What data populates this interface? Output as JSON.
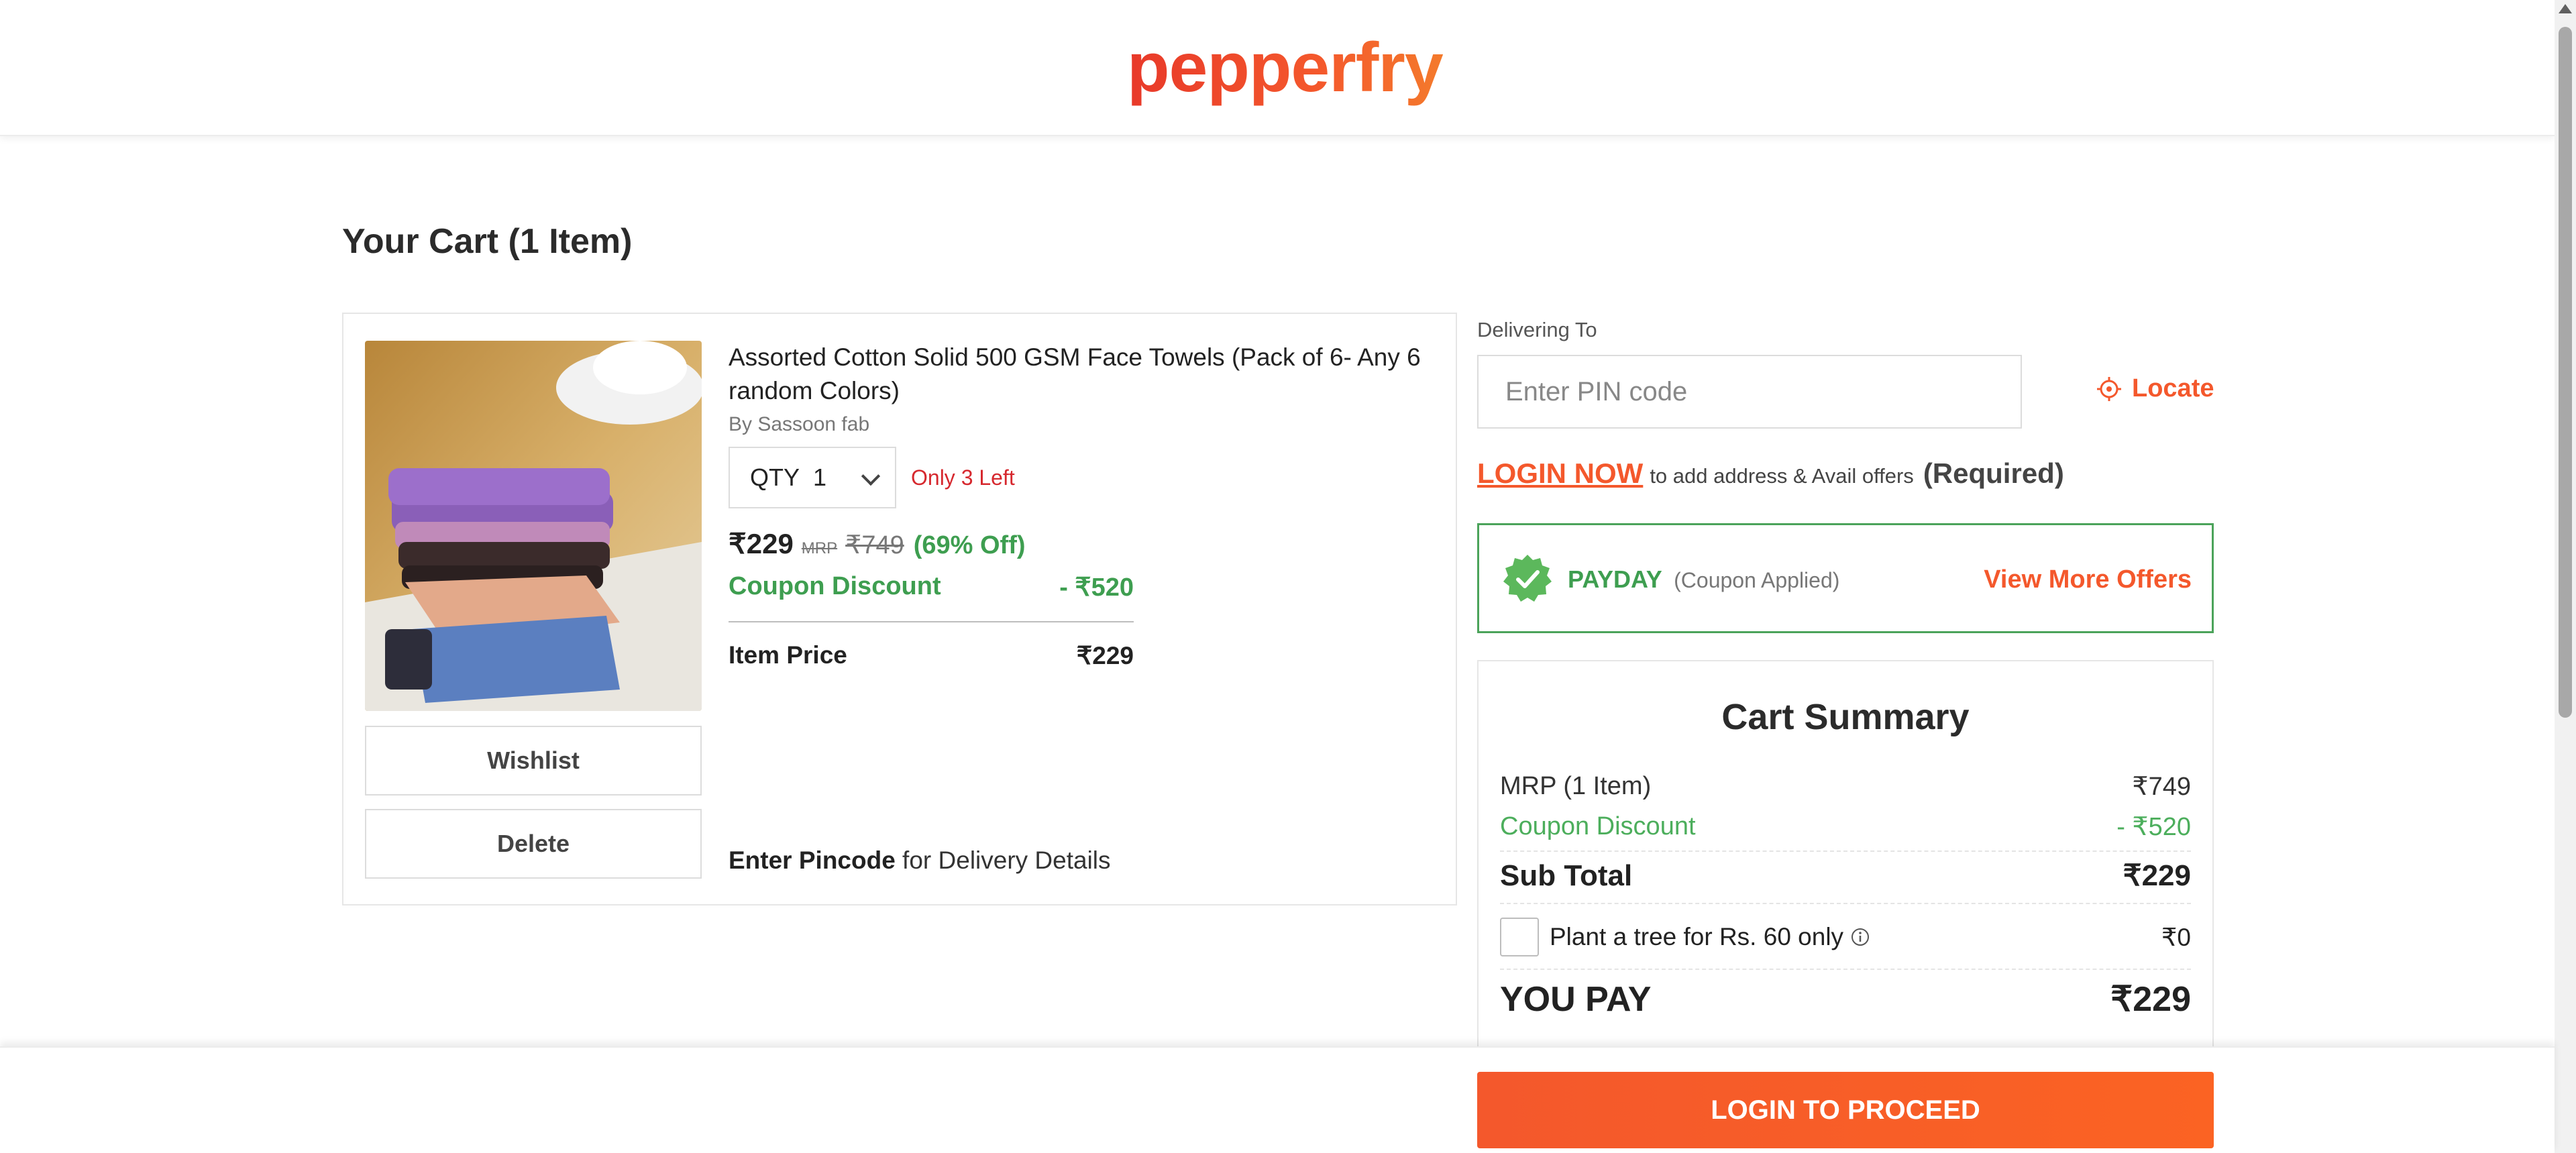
{
  "header": {
    "logo_text": "pepperfry",
    "brand_color": "#f4582c"
  },
  "cart": {
    "title": "Your Cart (1 Item)",
    "item": {
      "name": "Assorted Cotton Solid 500 GSM Face Towels (Pack of 6- Any 6 random Colors)",
      "seller": "By Sassoon fab",
      "qty_label": "QTY",
      "qty_value": "1",
      "stock_note": "Only 3 Left",
      "price": "₹229",
      "mrp_tag": "MRP",
      "mrp_price": "₹749",
      "discount_percent": "(69% Off)",
      "coupon_label": "Coupon Discount",
      "coupon_value": "- ₹520",
      "item_price_label": "Item Price",
      "item_price_value": "₹229",
      "wishlist_label": "Wishlist",
      "delete_label": "Delete",
      "pincode_bold": "Enter Pincode",
      "pincode_rest": " for Delivery Details"
    }
  },
  "delivery": {
    "label": "Delivering To",
    "pin_placeholder": "Enter PIN code",
    "locate_label": "Locate"
  },
  "login_prompt": {
    "link": "LOGIN NOW",
    "text": "to add address & Avail offers",
    "required": "(Required)"
  },
  "coupon_box": {
    "code": "PAYDAY",
    "status": "(Coupon Applied)",
    "view_more": "View More Offers",
    "accent": "#4ba35a"
  },
  "summary": {
    "title": "Cart Summary",
    "mrp_label": "MRP (1 Item)",
    "mrp_value": "₹749",
    "coupon_label": "Coupon Discount",
    "coupon_value": "- ₹520",
    "subtotal_label": "Sub Total",
    "subtotal_value": "₹229",
    "tree_label": "Plant a tree for Rs. 60 only",
    "tree_value": "₹0",
    "pay_label": "YOU PAY",
    "pay_value": "₹229"
  },
  "footer": {
    "proceed_label": "LOGIN TO PROCEED"
  },
  "icons": [
    "locate-icon",
    "coupon-check-badge-icon",
    "info-icon",
    "chevron-down-icon",
    "scroll-up-arrow-icon"
  ]
}
